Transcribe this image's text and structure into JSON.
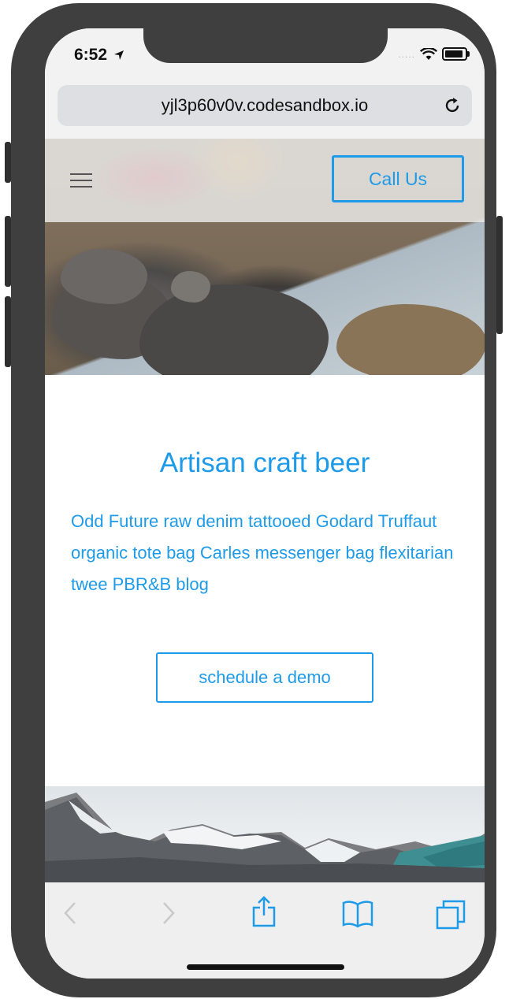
{
  "status_bar": {
    "time": "6:52",
    "signal": "....."
  },
  "browser": {
    "url": "yjl3p60v0v.codesandbox.io"
  },
  "nav": {
    "call_label": "Call Us"
  },
  "section": {
    "heading": "Artisan craft beer",
    "body": "Odd Future raw denim tattooed Godard Truffaut organic tote bag Carles messenger bag flexitarian twee PBR&B blog",
    "cta_label": "schedule a demo"
  },
  "colors": {
    "accent": "#1e9be8",
    "frame": "#3f3f3f",
    "toolbar_bg": "#efefef"
  },
  "toolbar_icons": [
    "back-icon",
    "forward-icon",
    "share-icon",
    "bookmarks-icon",
    "tabs-icon"
  ]
}
